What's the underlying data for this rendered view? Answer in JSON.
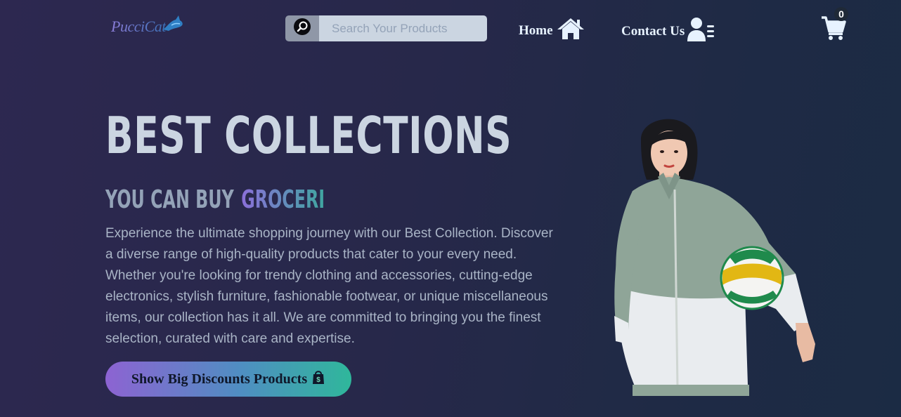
{
  "header": {
    "logo_text": "PucciCat",
    "search": {
      "placeholder": "Search Your Products",
      "icon": "search-icon"
    },
    "nav": [
      {
        "label": "Home",
        "icon": "house-icon"
      },
      {
        "label": "Contact Us",
        "icon": "user-lines-icon"
      }
    ],
    "cart": {
      "count": "0",
      "icon": "cart-icon"
    }
  },
  "hero": {
    "title": "BEST COLLECTIONS",
    "subtitle_lead": "YOU CAN BUY",
    "subtitle_accent": "GROCERI",
    "description": "Experience the ultimate shopping journey with our Best Collection. Discover a diverse range of high-quality products that cater to your every need. Whether you're looking for trendy clothing and accessories, cutting-edge electronics, stylish furniture, fashionable footwear, or unique miscellaneous items, our collection has it all. We are committed to bringing you the finest selection, curated with care and expertise.",
    "cta_label": "Show Big Discounts Products",
    "cta_icon": "shopping-bag-icon"
  },
  "colors": {
    "background_start": "#2d2850",
    "background_end": "#1b2b44",
    "title": "#cbd5e1",
    "accent_start": "#8b6fd9",
    "accent_end": "#3fa7a0"
  }
}
